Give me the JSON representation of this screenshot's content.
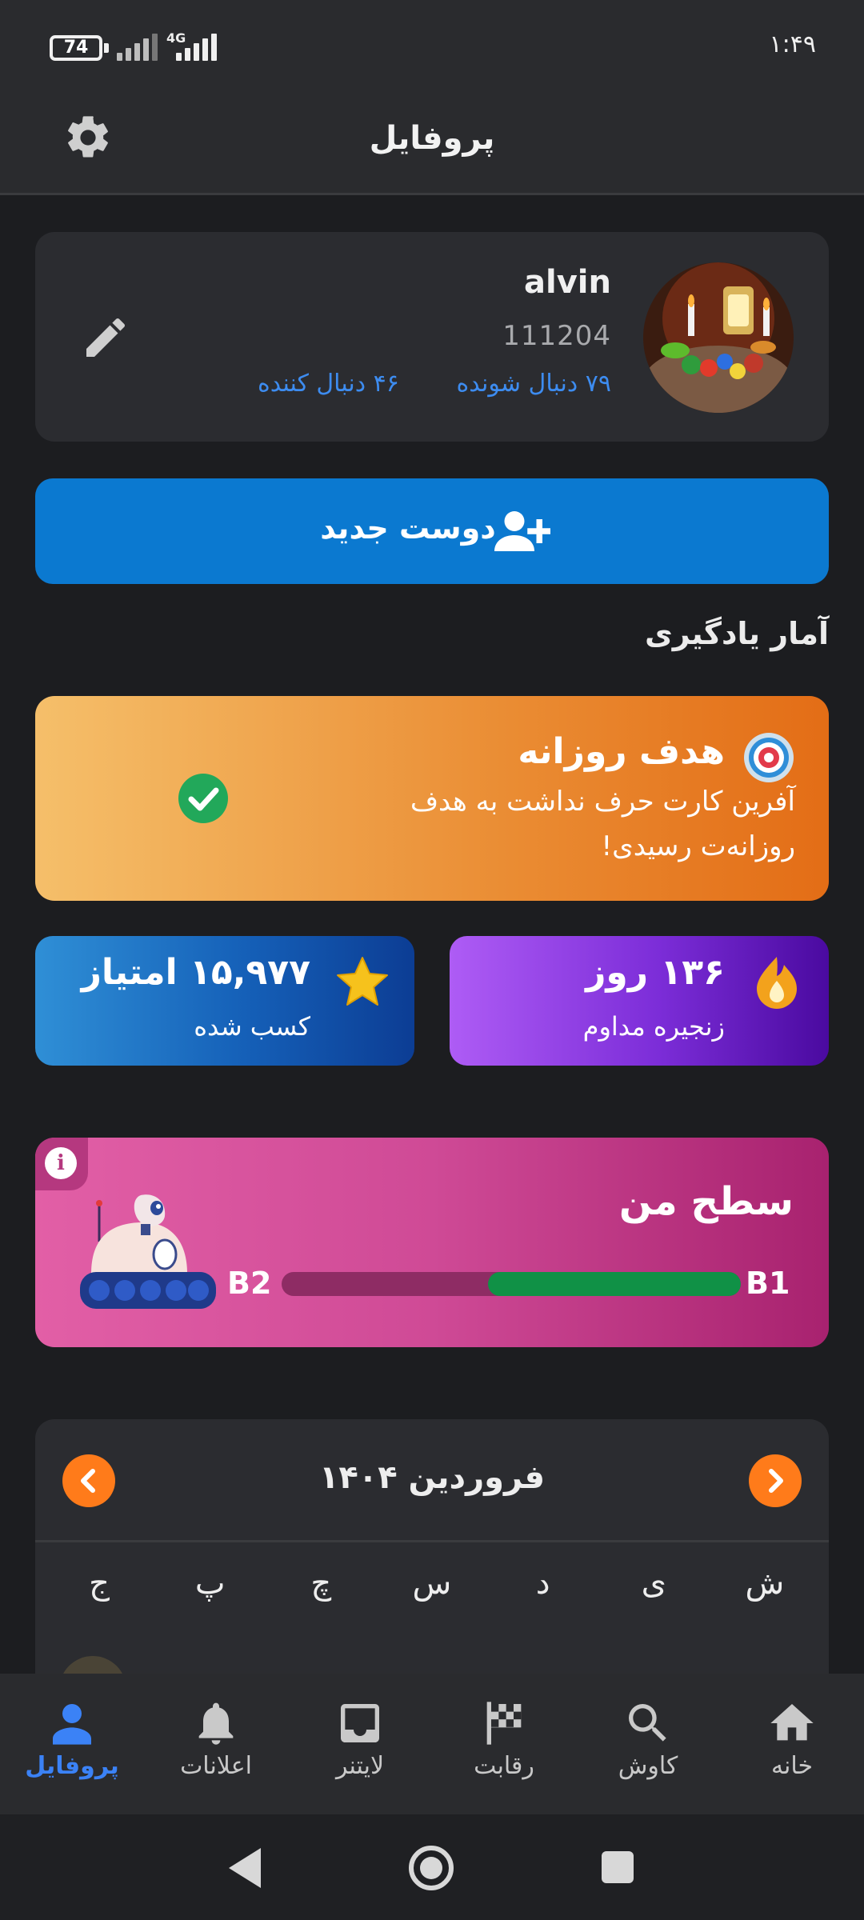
{
  "status_bar": {
    "battery": "74",
    "network": "4G",
    "time": "۱:۴۹"
  },
  "header": {
    "title": "پروفایل",
    "settings_icon": "gear-icon"
  },
  "profile": {
    "username": "alvin",
    "user_id": "111204",
    "following": "۷۹ دنبال شونده",
    "followers": "۴۶ دنبال کننده",
    "edit_icon": "pencil-icon"
  },
  "add_friend": {
    "label": "دوست جدید",
    "icon": "person-add-icon"
  },
  "stats_section": {
    "title": "آمار یادگیری"
  },
  "daily_goal": {
    "title": "هدف روزانه",
    "description": "آفرین کارت حرف نداشت به هدف روزانه‌ت رسیدی!",
    "completed": true
  },
  "streak": {
    "value": "۱۳۶ روز",
    "label": "زنجیره مداوم",
    "icon": "fire-icon"
  },
  "points": {
    "value": "۱۵,۹۷۷ امتیاز",
    "label": "کسب شده",
    "icon": "star-icon"
  },
  "level": {
    "title": "سطح من",
    "current": "B1",
    "next": "B2",
    "progress": 0.55
  },
  "calendar": {
    "month": "فروردین ۱۴۰۴",
    "weekdays": [
      "ش",
      "ی",
      "د",
      "س",
      "چ",
      "پ",
      "ج"
    ]
  },
  "bottom_nav": {
    "items": [
      {
        "label": "خانه",
        "icon": "home-icon"
      },
      {
        "label": "کاوش",
        "icon": "search-icon"
      },
      {
        "label": "رقابت",
        "icon": "race-flag-icon"
      },
      {
        "label": "لایتنر",
        "icon": "inbox-icon"
      },
      {
        "label": "اعلانات",
        "icon": "bell-icon"
      },
      {
        "label": "پروفایل",
        "icon": "person-icon",
        "active": true
      }
    ]
  },
  "colors": {
    "accent_blue": "#0b79d0",
    "link_blue": "#3d8cf0",
    "orange": "#ff7b1a",
    "progress_green": "#109146"
  }
}
